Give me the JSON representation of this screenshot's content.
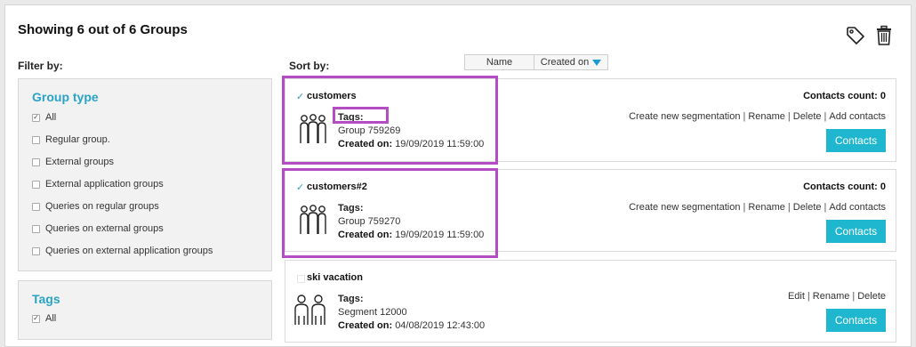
{
  "header": {
    "title": "Showing 6 out of 6 Groups",
    "filter_label": "Filter by:",
    "sort_label": "Sort by:",
    "icons": [
      "tag-icon",
      "trash-icon"
    ]
  },
  "sort": {
    "name_label": "Name",
    "created_label": "Created on",
    "active": "Created on"
  },
  "filters": {
    "group_type": {
      "title": "Group type",
      "options": [
        {
          "label": "All",
          "checked": true
        },
        {
          "label": "Regular group.",
          "checked": false
        },
        {
          "label": "External groups",
          "checked": false
        },
        {
          "label": "External application groups",
          "checked": false
        },
        {
          "label": "Queries on regular groups",
          "checked": false
        },
        {
          "label": "Queries on external groups",
          "checked": false
        },
        {
          "label": "Queries on external application groups",
          "checked": false
        }
      ]
    },
    "tags": {
      "title": "Tags",
      "options": [
        {
          "label": "All",
          "checked": true
        }
      ]
    }
  },
  "groups": [
    {
      "name": "customers",
      "checked": true,
      "tags_label": "Tags:",
      "subtitle": "Group 759269",
      "created_label": "Created on:",
      "created_value": "19/09/2019 11:59:00",
      "count_text": "Contacts count: 0",
      "actions": [
        "Create new segmentation",
        "Rename",
        "Delete",
        "Add contacts"
      ],
      "button": "Contacts"
    },
    {
      "name": "customers#2",
      "checked": true,
      "tags_label": "Tags:",
      "subtitle": "Group 759270",
      "created_label": "Created on:",
      "created_value": "19/09/2019 11:59:00",
      "count_text": "Contacts count: 0",
      "actions": [
        "Create new segmentation",
        "Rename",
        "Delete",
        "Add contacts"
      ],
      "button": "Contacts"
    },
    {
      "name": "ski vacation",
      "checked": false,
      "tags_label": "Tags:",
      "subtitle": "Segment 12000",
      "created_label": "Created on:",
      "created_value": "04/08/2019 12:43:00",
      "count_text": "",
      "actions": [
        "Edit",
        "Rename",
        "Delete"
      ],
      "button": "Contacts"
    }
  ],
  "colors": {
    "accent": "#29a3c6",
    "button": "#1fb7cf",
    "highlight": "#b44cc4"
  }
}
